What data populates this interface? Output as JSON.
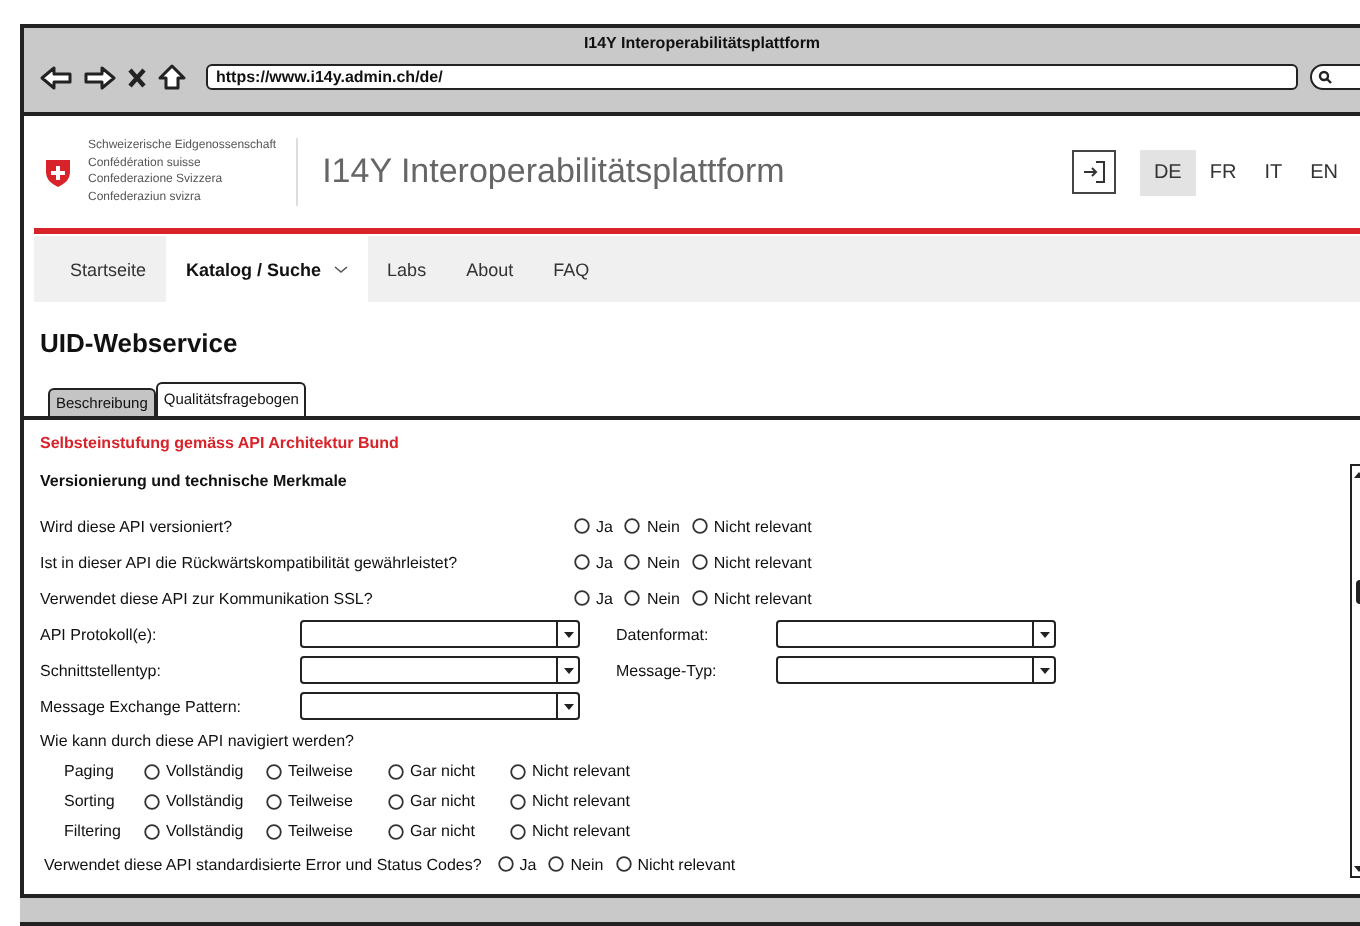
{
  "window": {
    "title": "I14Y Interoperabilitätsplattform"
  },
  "browser": {
    "url": "https://www.i14y.admin.ch/de/"
  },
  "header": {
    "confederation": [
      "Schweizerische Eidgenossenschaft",
      "Confédération suisse",
      "Confederazione Svizzera",
      "Confederaziun svizra"
    ],
    "site_title": "I14Y Interoperabilitätsplattform",
    "languages": [
      {
        "label": "DE",
        "selected": true
      },
      {
        "label": "FR",
        "selected": false
      },
      {
        "label": "IT",
        "selected": false
      },
      {
        "label": "EN",
        "selected": false
      }
    ]
  },
  "nav": [
    {
      "label": "Startseite",
      "selected": false,
      "has_menu": false
    },
    {
      "label": "Katalog / Suche",
      "selected": true,
      "has_menu": true
    },
    {
      "label": "Labs",
      "selected": false,
      "has_menu": false
    },
    {
      "label": "About",
      "selected": false,
      "has_menu": false
    },
    {
      "label": "FAQ",
      "selected": false,
      "has_menu": false
    }
  ],
  "page_title": "UID-Webservice",
  "tabs": [
    {
      "label": "Beschreibung",
      "selected": false
    },
    {
      "label": "Qualitätsfragebogen",
      "selected": true
    }
  ],
  "form": {
    "heading": "Selbsteinstufung gemäss API Architektur Bund",
    "section": "Versionierung und technische Merkmale",
    "questions": [
      {
        "label": "Wird diese API versioniert?",
        "options": [
          {
            "label": "Ja",
            "selected": false
          },
          {
            "label": "Nein",
            "selected": false
          },
          {
            "label": "Nicht relevant",
            "selected": false
          }
        ]
      },
      {
        "label": "Ist in dieser API die Rückwärtskompatibilität gewährleistet?",
        "options": [
          {
            "label": "Ja",
            "selected": false
          },
          {
            "label": "Nein",
            "selected": false
          },
          {
            "label": "Nicht relevant",
            "selected": false
          }
        ]
      },
      {
        "label": "Verwendet diese API zur Kommunikation SSL?",
        "options": [
          {
            "label": "Ja",
            "selected": false
          },
          {
            "label": "Nein",
            "selected": false
          },
          {
            "label": "Nicht relevant",
            "selected": false
          }
        ]
      }
    ],
    "dropdown_rows": [
      [
        {
          "label": "API Protokoll(e):"
        },
        {
          "label": "Datenformat:"
        }
      ],
      [
        {
          "label": "Schnittstellentyp:"
        },
        {
          "label": "Message-Typ:"
        }
      ],
      [
        {
          "label": "Message Exchange Pattern:"
        }
      ]
    ],
    "navigation": {
      "label": "Wie kann durch diese API navigiert werden?",
      "rows": [
        {
          "label": "Paging",
          "options": [
            {
              "label": "Vollständig",
              "selected": false
            },
            {
              "label": "Teilweise",
              "selected": false
            },
            {
              "label": "Gar nicht",
              "selected": false
            },
            {
              "label": "Nicht relevant",
              "selected": false
            }
          ]
        },
        {
          "label": "Sorting",
          "options": [
            {
              "label": "Vollständig",
              "selected": false
            },
            {
              "label": "Teilweise",
              "selected": false
            },
            {
              "label": "Gar nicht",
              "selected": false
            },
            {
              "label": "Nicht relevant",
              "selected": false
            }
          ]
        },
        {
          "label": "Filtering",
          "options": [
            {
              "label": "Vollständig",
              "selected": false
            },
            {
              "label": "Teilweise",
              "selected": false
            },
            {
              "label": "Gar nicht",
              "selected": false
            },
            {
              "label": "Nicht relevant",
              "selected": false
            }
          ]
        }
      ]
    },
    "final_question": {
      "label": "Verwendet diese API standardisierte Error und Status Codes?",
      "options": [
        {
          "label": "Ja",
          "selected": false
        },
        {
          "label": "Nein",
          "selected": false
        },
        {
          "label": "Nicht relevant",
          "selected": false
        }
      ]
    }
  }
}
